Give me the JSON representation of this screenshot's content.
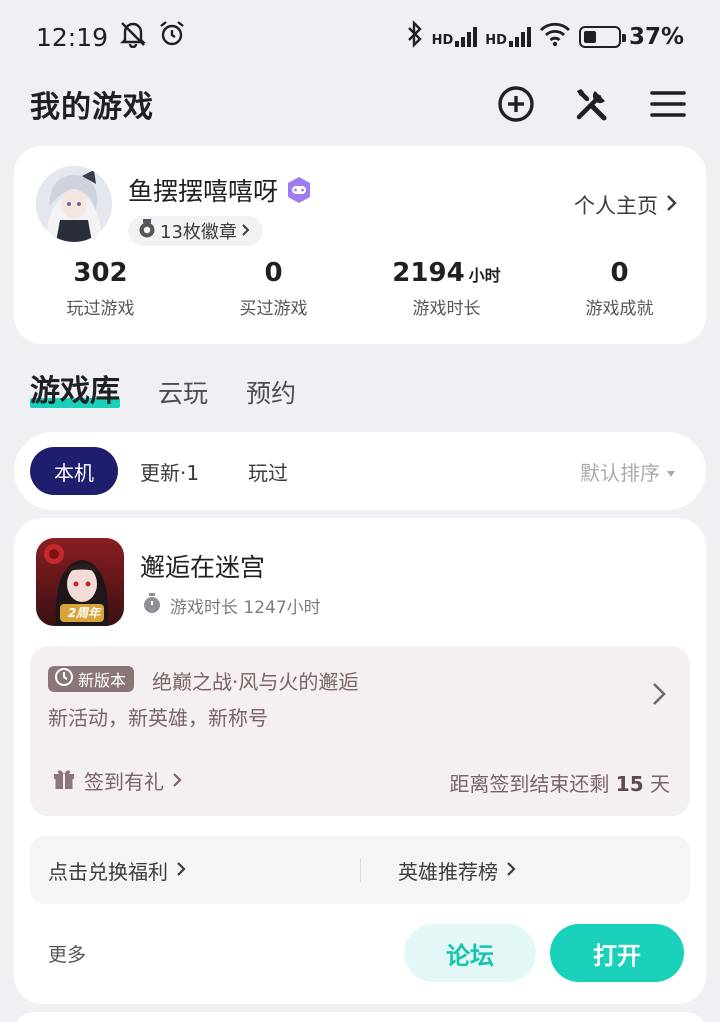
{
  "status_bar": {
    "time": "12:19",
    "network_1": "HD",
    "network_2": "HD",
    "battery_percent": "37%",
    "battery_level": 0.37,
    "icons": [
      "mute-icon",
      "alarm-icon",
      "bluetooth-icon",
      "signal-icon",
      "wifi-icon",
      "battery-icon"
    ]
  },
  "header": {
    "title": "我的游戏",
    "icons": [
      "add-circle-icon",
      "tools-icon",
      "menu-icon"
    ]
  },
  "profile": {
    "username": "鱼摆摆嘻嘻呀",
    "badge_count_label": "13枚徽章",
    "profile_link": "个人主页",
    "stats": [
      {
        "value": "302",
        "unit": "",
        "label": "玩过游戏"
      },
      {
        "value": "0",
        "unit": "",
        "label": "买过游戏"
      },
      {
        "value": "2194",
        "unit": "小时",
        "label": "游戏时长"
      },
      {
        "value": "0",
        "unit": "",
        "label": "游戏成就"
      }
    ]
  },
  "tabs": [
    {
      "label": "游戏库",
      "active": true
    },
    {
      "label": "云玩",
      "active": false
    },
    {
      "label": "预约",
      "active": false
    }
  ],
  "filters": {
    "chips": [
      "本机",
      "更新·1",
      "玩过"
    ],
    "active_index": 0,
    "sort_label": "默认排序"
  },
  "game": {
    "name": "邂逅在迷宫",
    "play_time": "游戏时长 1247小时",
    "icon_badge": "2周年",
    "update": {
      "tag": "新版本",
      "title": "绝巅之战·风与火的邂逅",
      "subtitle": "新活动，新英雄，新称号"
    },
    "signin": {
      "label": "签到有礼",
      "remaining_prefix": "距离签到结束还剩",
      "remaining_days": "15",
      "remaining_suffix": "天"
    },
    "links": [
      "点击兑换福利",
      "英雄推荐榜"
    ],
    "more": "更多",
    "forum_button": "论坛",
    "open_button": "打开"
  },
  "colors": {
    "accent": "#19d1bb",
    "chip_active": "#1f1e6e",
    "update_bg": "#f5f0f0",
    "update_text": "#7a6464"
  }
}
